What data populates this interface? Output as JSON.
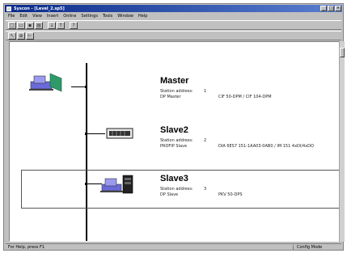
{
  "window": {
    "title": "Syscon - [Level_2.sp5]",
    "controls": [
      "_",
      "□",
      "×"
    ]
  },
  "menu": [
    "File",
    "Edit",
    "View",
    "Insert",
    "Online",
    "Settings",
    "Tools",
    "Window",
    "Help"
  ],
  "toolbar1": [
    "new-icon",
    "open-icon",
    "save-icon",
    "print-icon",
    "download-icon",
    "upload-icon",
    "help-icon"
  ],
  "toolbar2": [
    "select-icon",
    "zoom-icon",
    "connect-icon"
  ],
  "stations": [
    {
      "name": "Master",
      "address_label": "Station address:",
      "address": "1",
      "type_label": "DP Master",
      "type_value": "CIF 50-DPM / CIF 104-DPM"
    },
    {
      "name": "Slave2",
      "address_label": "Station address:",
      "address": "2",
      "type_label": "PROFIP Slave",
      "type_value": "DIA 6ES7 151-1AA03-0AB0 / IM 151 4xDI/4xDO"
    },
    {
      "name": "Slave3",
      "address_label": "Station address:",
      "address": "3",
      "type_label": "DP Slave",
      "type_value": "PKV 50-DPS"
    }
  ],
  "status": {
    "left": "For Help, press F1",
    "right": "Config Mode"
  }
}
